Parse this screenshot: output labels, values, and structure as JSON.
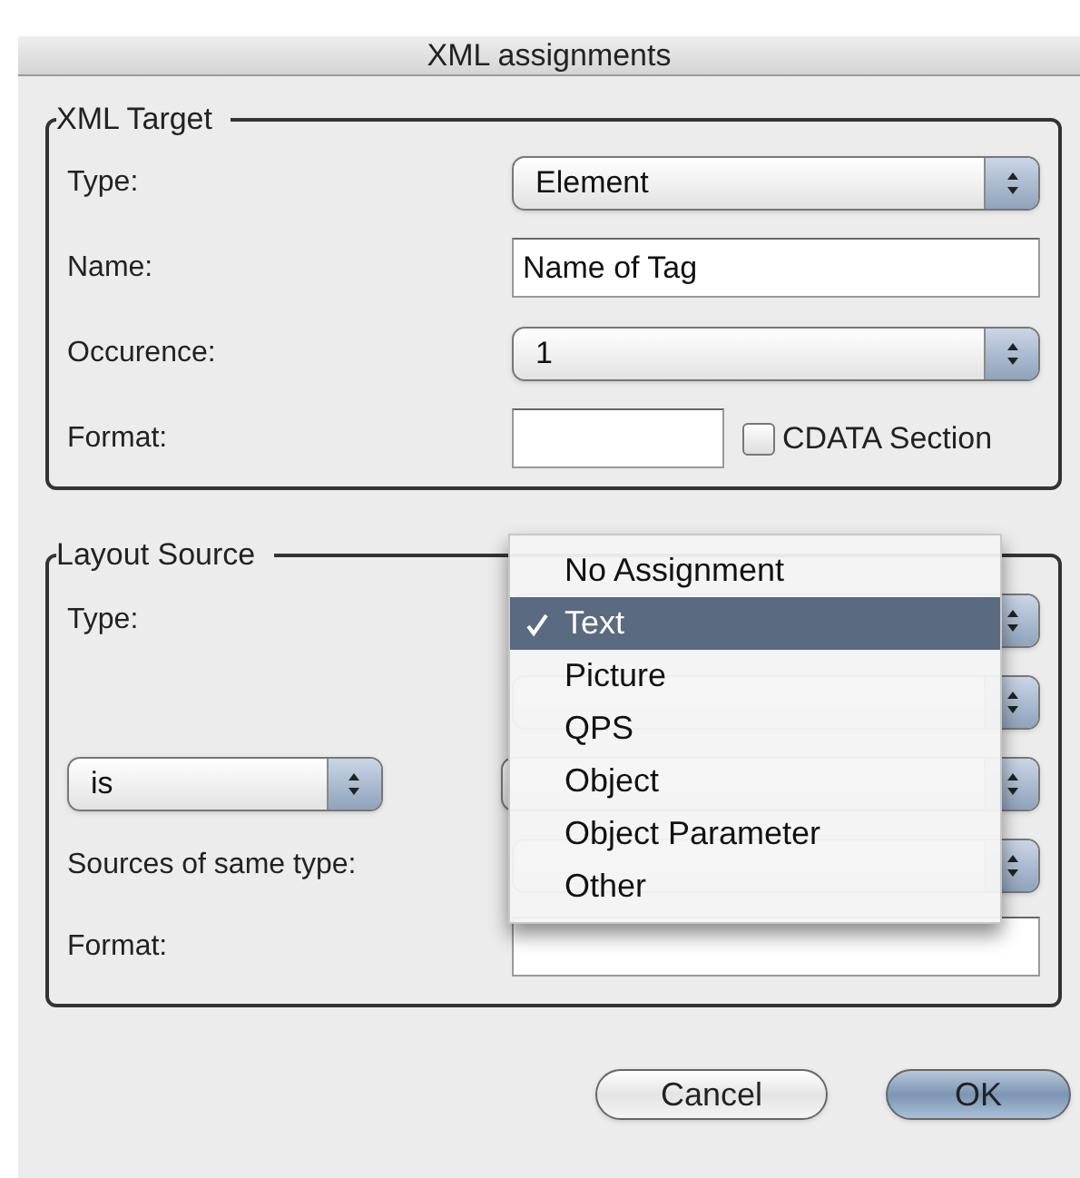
{
  "window": {
    "title": "XML assignments"
  },
  "xml_target": {
    "title": "XML Target",
    "rows": [
      {
        "kind": "popup",
        "label": "Type:",
        "value": "Element"
      },
      {
        "kind": "text",
        "label": "Name:",
        "value": "Name of Tag"
      },
      {
        "kind": "popup",
        "label": "Occurence:",
        "value": "1"
      },
      {
        "kind": "format",
        "label": "Format:",
        "checkbox": {
          "label": "CDATA Section",
          "checked": false
        }
      }
    ]
  },
  "layout_source": {
    "title": "Layout Source",
    "rows": [
      {
        "kind": "popup",
        "label": "Type:"
      },
      {
        "kind": "popup"
      },
      {
        "kind": "split",
        "left_value": "is"
      },
      {
        "kind": "popup",
        "label": "Sources of same type:"
      },
      {
        "kind": "text",
        "label": "Format:"
      }
    ]
  },
  "menu": {
    "items": [
      {
        "label": "No Assignment",
        "selected": false
      },
      {
        "label": "Text",
        "selected": true
      },
      {
        "label": "Picture",
        "selected": false
      },
      {
        "label": "QPS",
        "selected": false
      },
      {
        "label": "Object",
        "selected": false
      },
      {
        "label": "Object Parameter",
        "selected": false
      },
      {
        "label": "Other",
        "selected": false
      }
    ]
  },
  "buttons": [
    {
      "label": "Cancel",
      "default": false
    },
    {
      "label": "OK",
      "default": true
    }
  ]
}
